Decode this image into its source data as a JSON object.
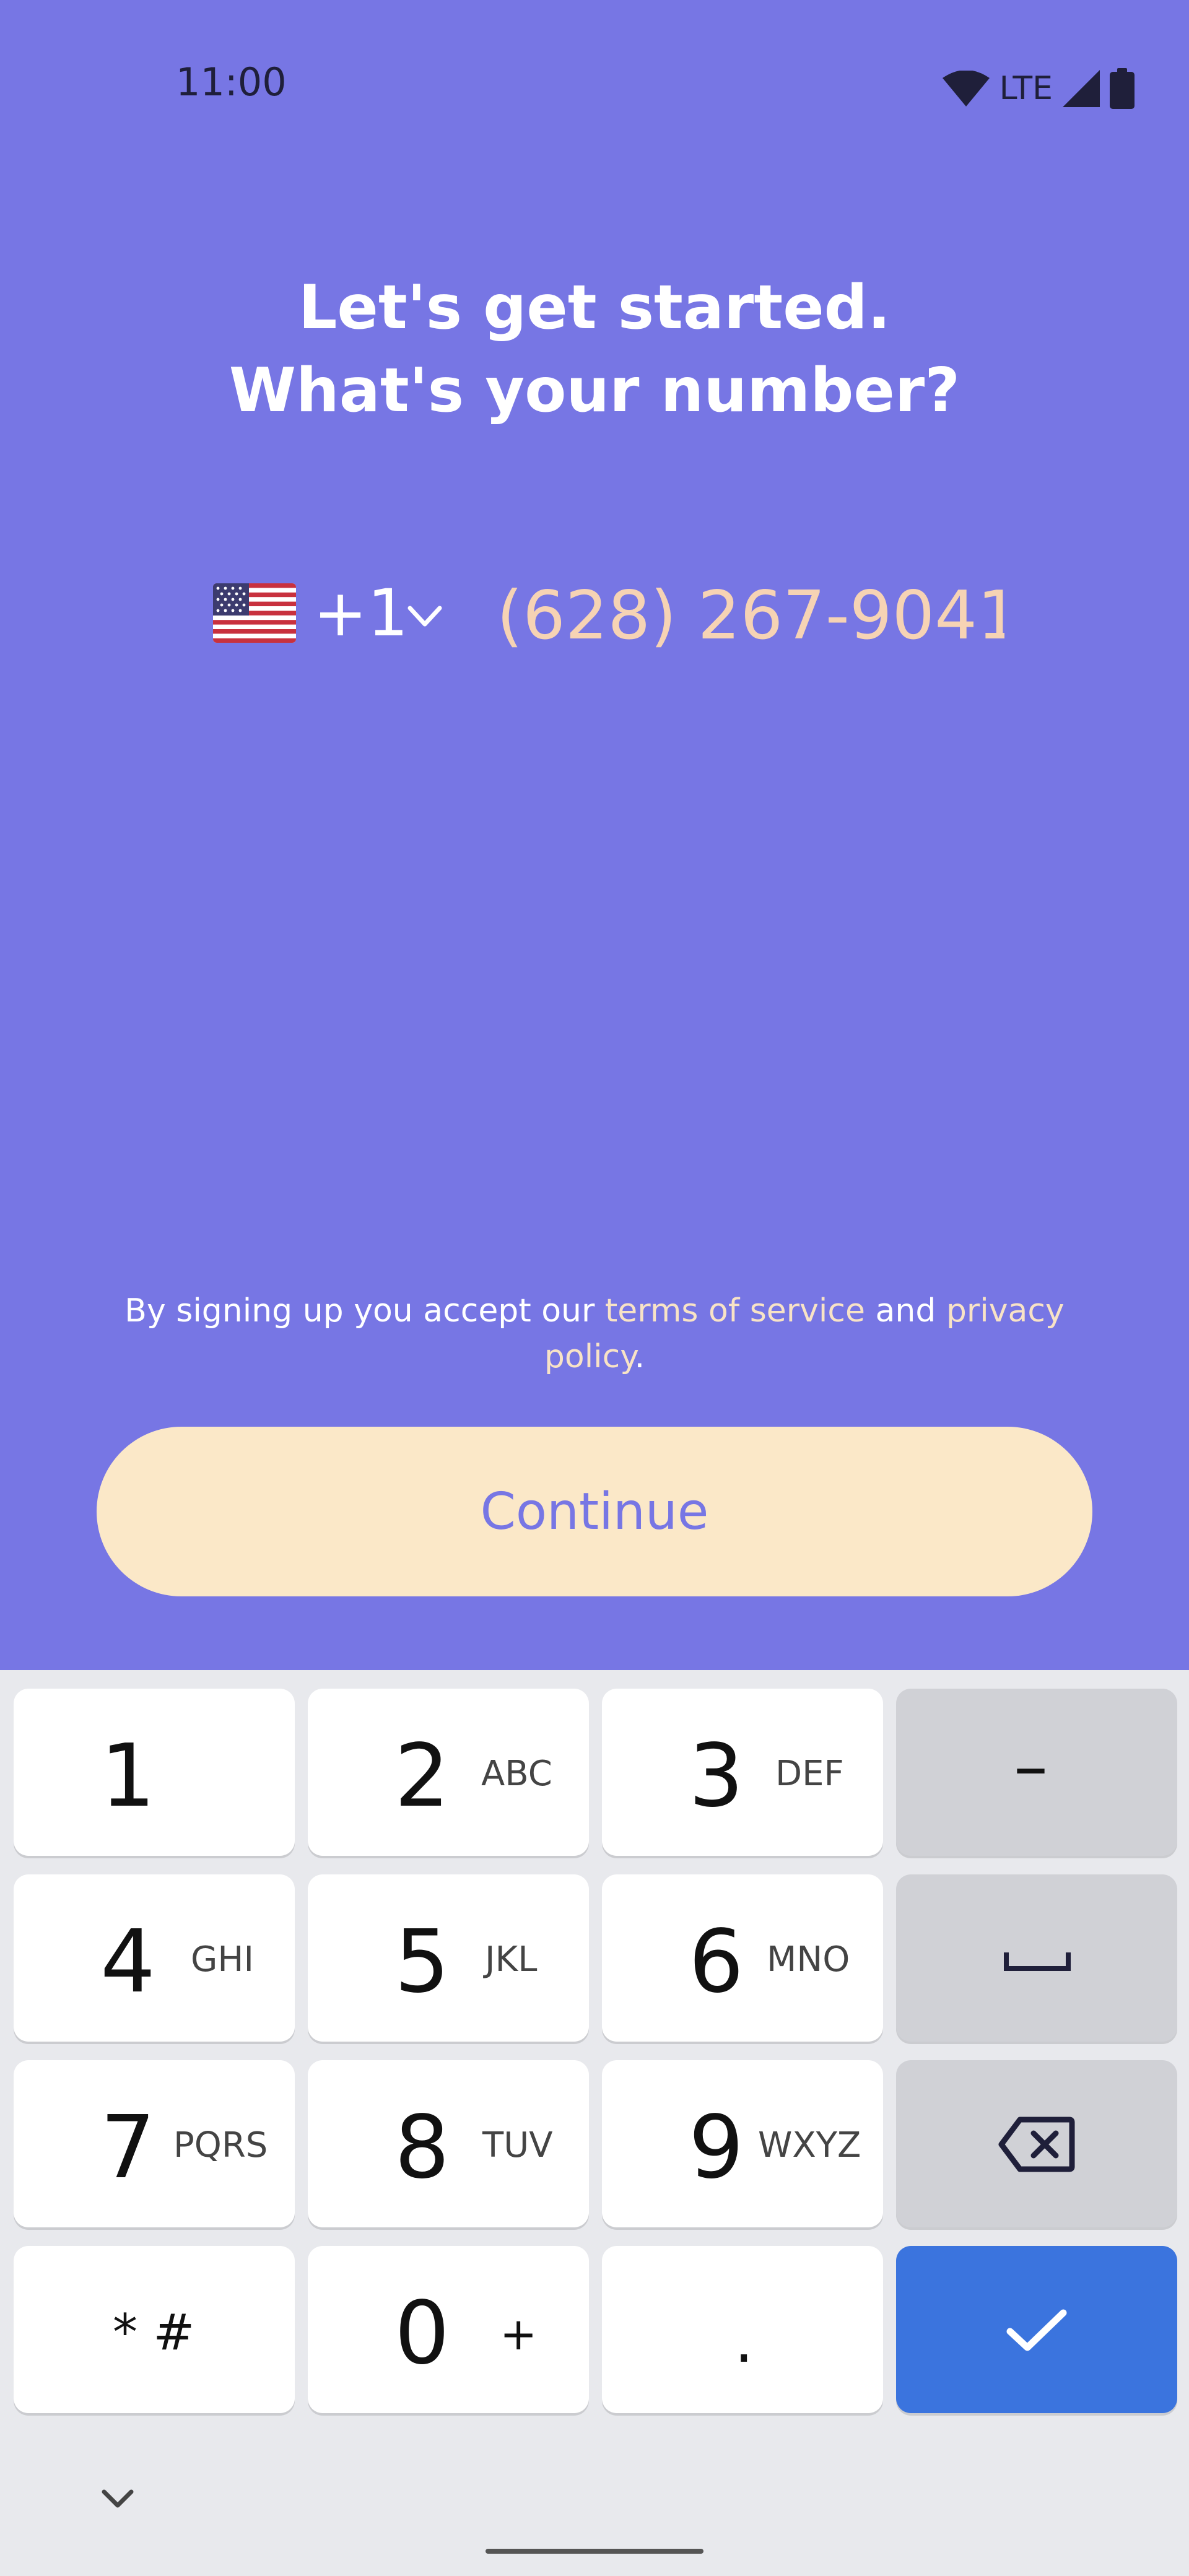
{
  "status_bar": {
    "time": "11:00",
    "network": "LTE",
    "icons": [
      "wifi-icon",
      "cell-signal-icon",
      "battery-icon"
    ]
  },
  "headline": {
    "line1": "Let's get started.",
    "line2": "What's your number?"
  },
  "phone": {
    "country_flag": "us-flag-icon",
    "country_code": "+1",
    "placeholder": "(628) 267-9041"
  },
  "terms": {
    "prefix": "By signing up you accept our ",
    "tos_link": "terms of service",
    "middle": " and ",
    "privacy_link": "privacy policy",
    "suffix": "."
  },
  "continue_label": "Continue",
  "keyboard": {
    "keys": [
      {
        "digit": "1",
        "letters": ""
      },
      {
        "digit": "2",
        "letters": "ABC"
      },
      {
        "digit": "3",
        "letters": "DEF"
      },
      {
        "digit": "4",
        "letters": "GHI"
      },
      {
        "digit": "5",
        "letters": "JKL"
      },
      {
        "digit": "6",
        "letters": "MNO"
      },
      {
        "digit": "7",
        "letters": "PQRS"
      },
      {
        "digit": "8",
        "letters": "TUV"
      },
      {
        "digit": "9",
        "letters": "WXYZ"
      },
      {
        "digit": "0",
        "letters": "+"
      }
    ],
    "star_hash": "* #",
    "dot": ".",
    "dash": "–"
  },
  "colors": {
    "background": "#7776e4",
    "button_bg": "#fbe8c8",
    "button_text": "#7776e4",
    "placeholder": "#f6d3b4",
    "enter_key": "#3b74de"
  }
}
